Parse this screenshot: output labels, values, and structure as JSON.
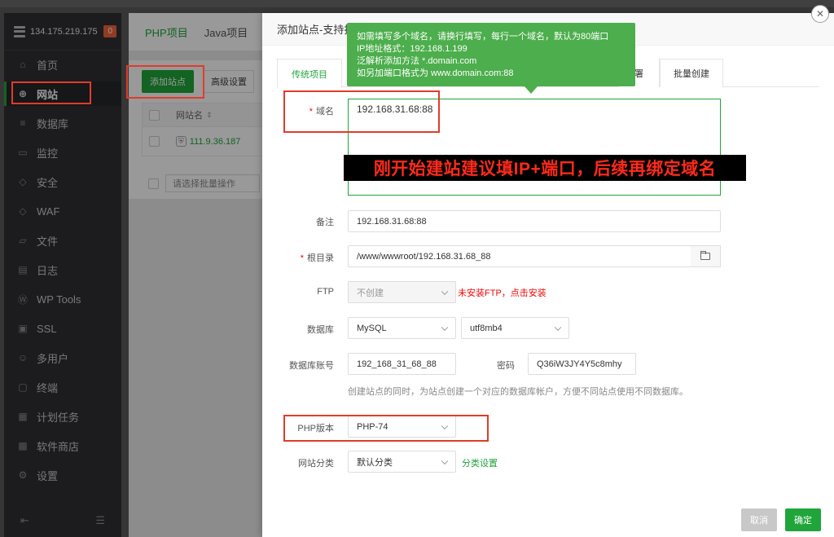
{
  "sidebar": {
    "server_ip": "134.175.219.175",
    "server_badge": "0",
    "items": [
      {
        "label": "首页",
        "icon": "home-icon",
        "glyph": "⌂"
      },
      {
        "label": "网站",
        "icon": "globe-icon",
        "glyph": "⊕"
      },
      {
        "label": "数据库",
        "icon": "database-icon",
        "glyph": "≡"
      },
      {
        "label": "监控",
        "icon": "monitor-icon",
        "glyph": "▭"
      },
      {
        "label": "安全",
        "icon": "shield-icon",
        "glyph": "◇"
      },
      {
        "label": "WAF",
        "icon": "waf-icon",
        "glyph": "◇"
      },
      {
        "label": "文件",
        "icon": "folder-icon",
        "glyph": "▱"
      },
      {
        "label": "日志",
        "icon": "log-icon",
        "glyph": "▤"
      },
      {
        "label": "WP Tools",
        "icon": "wordpress-icon",
        "glyph": "Ⓦ"
      },
      {
        "label": "SSL",
        "icon": "ssl-icon",
        "glyph": "▣"
      },
      {
        "label": "多用户",
        "icon": "users-icon",
        "glyph": "☺"
      },
      {
        "label": "终端",
        "icon": "terminal-icon",
        "glyph": "▢"
      },
      {
        "label": "计划任务",
        "icon": "schedule-icon",
        "glyph": "▦"
      },
      {
        "label": "软件商店",
        "icon": "store-icon",
        "glyph": "▩"
      },
      {
        "label": "设置",
        "icon": "settings-icon",
        "glyph": "⚙"
      }
    ],
    "active_index": 1
  },
  "bg_page": {
    "tabs": [
      "PHP项目",
      "Java项目"
    ],
    "add_site": "添加站点",
    "advanced": "高级设置",
    "col_site_name": "网站名",
    "row_site": "111.9.36.187",
    "batch_placeholder": "请选择批量操作"
  },
  "dialog": {
    "title": "添加站点-支持批",
    "tabs": [
      "传统项目",
      "署",
      "批量创建"
    ],
    "domain_label": "域名",
    "domain_value": "192.168.31.68:88",
    "remark_label": "备注",
    "remark_value": "192.168.31.68:88",
    "root_label": "根目录",
    "root_value": "/www/wwwroot/192.168.31.68_88",
    "ftp_label": "FTP",
    "ftp_value": "不创建",
    "ftp_warning": "未安装FTP，点击安装",
    "db_label": "数据库",
    "db_value": "MySQL",
    "charset_value": "utf8mb4",
    "db_account_label": "数据库账号",
    "db_account_value": "192_168_31_68_88",
    "password_label": "密码",
    "password_value": "Q36iW3JY4Y5c8mhy",
    "db_hint": "创建站点的同时，为站点创建一个对应的数据库帐户，方便不同站点使用不同数据库。",
    "php_label": "PHP版本",
    "php_value": "PHP-74",
    "category_label": "网站分类",
    "category_value": "默认分类",
    "category_link": "分类设置",
    "cancel": "取消",
    "confirm": "确定"
  },
  "tooltip": {
    "lines": [
      "如需填写多个域名，请换行填写，每行一个域名，默认为80端口",
      "IP地址格式：192.168.1.199",
      "泛解析添加方法 *.domain.com",
      "如另加端口格式为 www.domain.com:88"
    ]
  },
  "annotation": {
    "banner": "刚开始建站建议填IP+端口，后续再绑定域名"
  },
  "colors": {
    "accent": "#20a53a",
    "sidebar_bg": "#2f3034",
    "annotation_red": "#e23b2a",
    "tooltip_bg": "#4cae4c"
  }
}
